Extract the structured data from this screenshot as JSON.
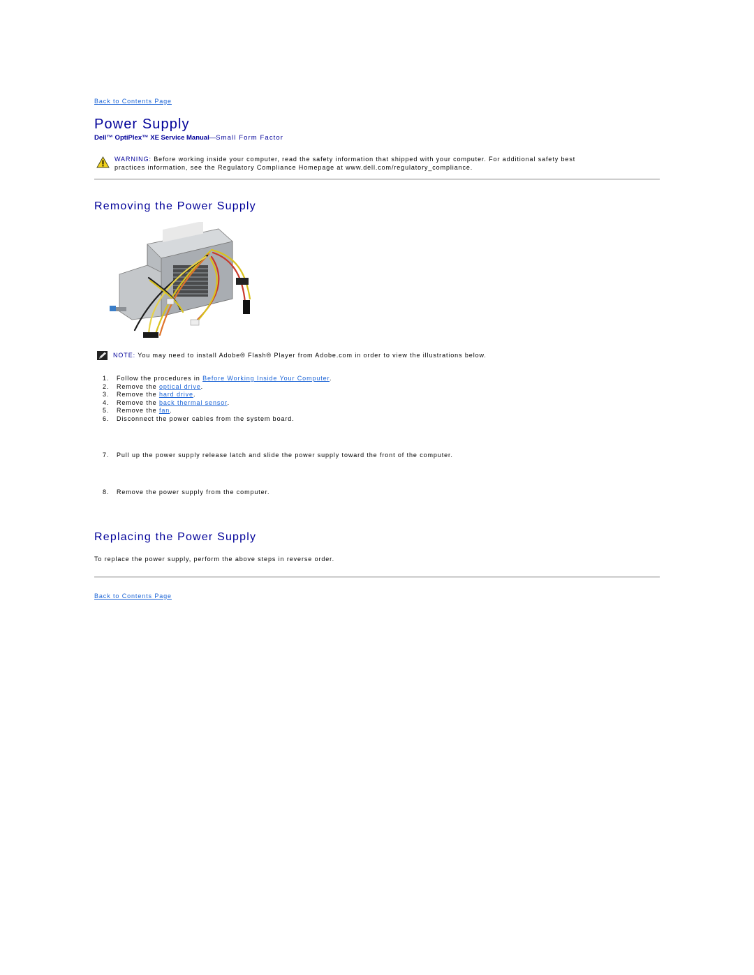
{
  "nav": {
    "back_to_contents_top": "Back to Contents Page",
    "back_to_contents_bottom": "Back to Contents Page"
  },
  "header": {
    "title": "Power Supply",
    "manual_name": "Dell™ OptiPlex™ XE Service Manual",
    "separator": "—",
    "form_factor": "Small Form Factor"
  },
  "warning": {
    "icon": "warning-triangle-icon",
    "label": "WARNING:",
    "line1": " Before working inside your computer, read the safety information that shipped with your computer. For additional safety best",
    "line2": "practices information, see the Regulatory Compliance Homepage at www.dell.com/regulatory_compliance."
  },
  "removing": {
    "heading": "Removing the Power Supply",
    "illustration_alt": "Power supply unit with attached cables",
    "note": {
      "icon": "note-pencil-icon",
      "label": "NOTE:",
      "text": " You may need to install Adobe® Flash® Player from Adobe.com in order to view the illustrations below."
    },
    "steps": [
      {
        "num": "1.",
        "before": "Follow the procedures in ",
        "link": "Before Working Inside Your Computer",
        "after": "."
      },
      {
        "num": "2.",
        "before": "Remove the ",
        "link": "optical drive",
        "after": "."
      },
      {
        "num": "3.",
        "before": "Remove the ",
        "link": "hard drive",
        "after": "."
      },
      {
        "num": "4.",
        "before": "Remove the ",
        "link": "back thermal sensor",
        "after": "."
      },
      {
        "num": "5.",
        "before": "Remove the ",
        "link": "fan",
        "after": "."
      },
      {
        "num": "6.",
        "text": "Disconnect the power cables from the system board."
      },
      {
        "num": "7.",
        "text": "Pull up the power supply release latch and slide the power supply toward the front of the computer."
      },
      {
        "num": "8.",
        "text": "Remove the power supply from the computer."
      }
    ]
  },
  "replacing": {
    "heading": "Replacing the Power Supply",
    "text": "To replace the power supply, perform the above steps in reverse order."
  },
  "colors": {
    "heading": "#000099",
    "link": "#1a63d6",
    "body_text": "#000000",
    "divider": "#aaaaaa",
    "warning_icon": "#f2d21c"
  }
}
